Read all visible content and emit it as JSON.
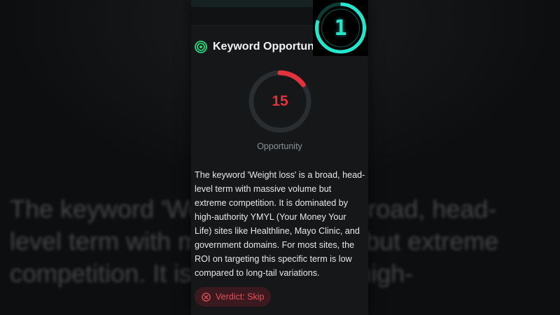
{
  "card": {
    "title": "Keyword Opportunity",
    "score": "15",
    "score_fraction": 0.15,
    "score_label": "Opportunity",
    "description": "The keyword 'Weight loss' is a broad, head-level term with massive volume but extreme competition. It is dominated by high-authority YMYL (Your Money Your Life) sites like Healthline, Mayo Clinic, and government domains. For most sites, the ROI on targeting this specific term is low compared to long-tail variations.",
    "verdict": "Verdict: Skip"
  },
  "background_text": {
    "line1": "The keyword 'Weight loss' is a broad, head-",
    "line2": "level term with massive volume but extreme",
    "line3": "competition. It is dominated by high-"
  },
  "timer": {
    "digit": "1",
    "progress_fraction": 0.8
  },
  "icons": {
    "title": "target-icon",
    "verdict": "close-circle-icon"
  },
  "colors": {
    "accent_green": "#2bd67b",
    "score_red": "#e2323e",
    "verdict_bg": "#3a1a1e",
    "timer_cyan": "#23e6cc",
    "card_bg": "#151719"
  }
}
